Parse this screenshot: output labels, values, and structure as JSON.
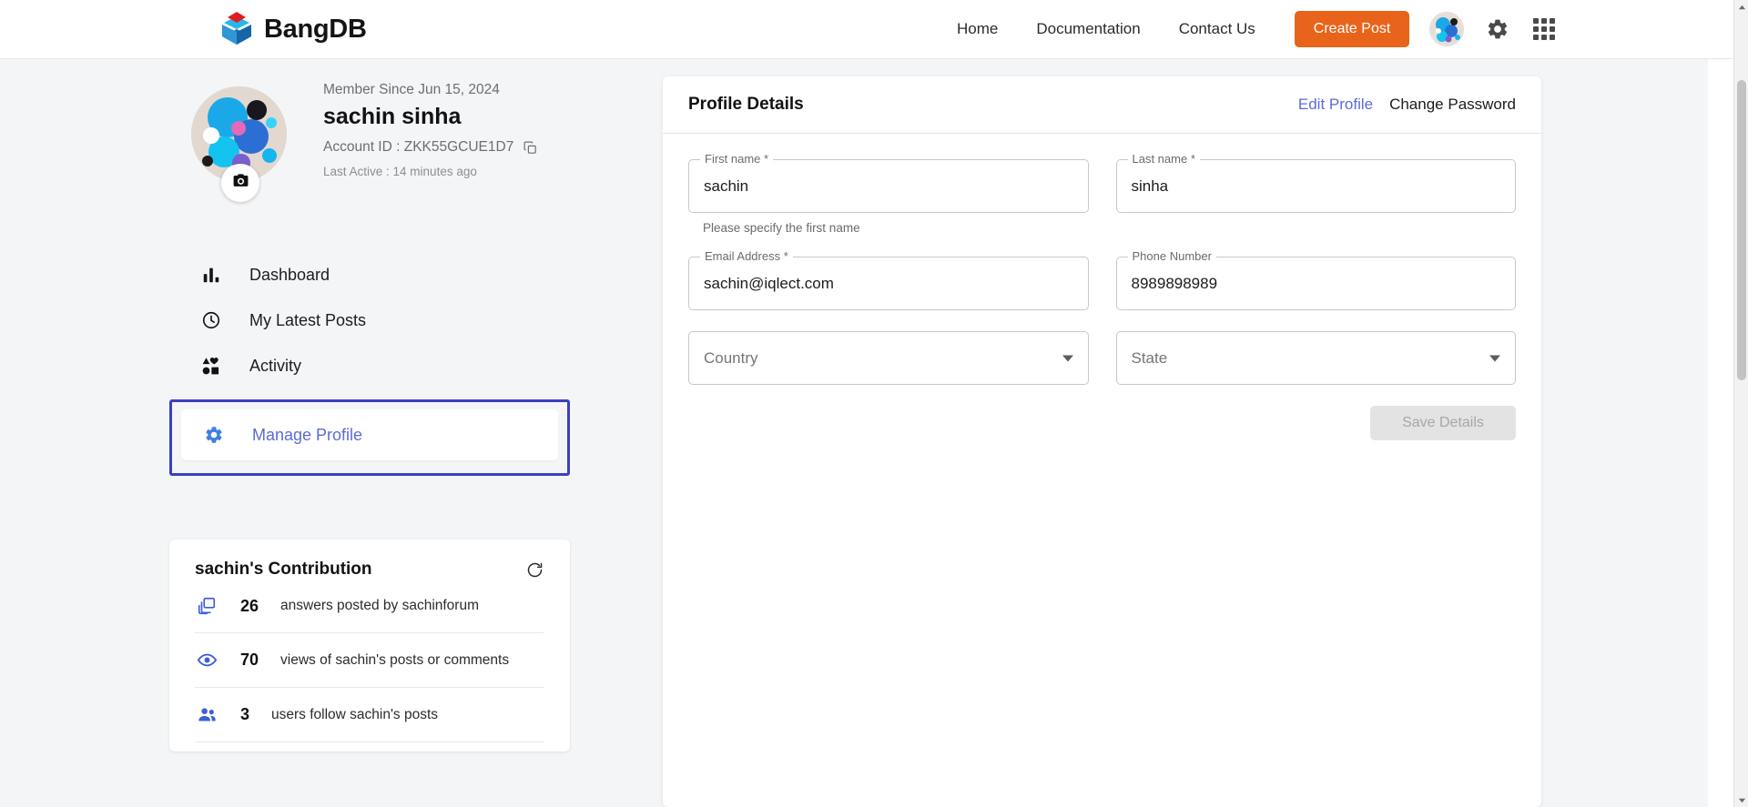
{
  "topbar": {
    "brand": "BangDB",
    "brand_logo_icon": "bangdb-cube-logo",
    "nav": [
      {
        "label": "Home",
        "name": "nav-home"
      },
      {
        "label": "Documentation",
        "name": "nav-documentation"
      },
      {
        "label": "Contact Us",
        "name": "nav-contact-us"
      }
    ],
    "create_post_label": "Create Post",
    "create_post_color": "#e8641a",
    "avatar_icon": "user-avatar",
    "settings_icon": "gear-icon",
    "apps_icon": "apps-grid-icon"
  },
  "profile": {
    "member_since": "Member Since Jun 15, 2024",
    "name": "sachin sinha",
    "account_id": "Account ID : ZKK55GCUE1D7",
    "copy_icon": "copy-icon",
    "last_active": "Last Active : 14 minutes ago",
    "camera_icon": "camera-icon",
    "avatar_icon": "profile-avatar"
  },
  "sidebar": {
    "items": [
      {
        "label": "Dashboard",
        "icon": "bar-chart-icon",
        "active": false
      },
      {
        "label": "My Latest Posts",
        "icon": "clock-icon",
        "active": false
      },
      {
        "label": "Activity",
        "icon": "shapes-icon",
        "active": false
      },
      {
        "label": "Manage Profile",
        "icon": "gear-icon",
        "active": true
      }
    ],
    "active_color": "#5b6bd6",
    "highlight_border_color": "#3b3fc4"
  },
  "contribution": {
    "title": "sachin's Contribution",
    "refresh_icon": "refresh-icon",
    "rows": [
      {
        "icon": "answers-copy-icon",
        "count": "26",
        "text": "answers posted by sachinforum"
      },
      {
        "icon": "eye-icon",
        "count": "70",
        "text": "views of sachin's posts or comments"
      },
      {
        "icon": "people-icon",
        "count": "3",
        "text": "users follow sachin's posts"
      }
    ]
  },
  "panel": {
    "title": "Profile Details",
    "edit_profile_label": "Edit Profile",
    "change_password_label": "Change Password",
    "fields": {
      "first_name": {
        "label": "First name *",
        "value": "sachin",
        "helper": "Please specify the first name"
      },
      "last_name": {
        "label": "Last name *",
        "value": "sinha"
      },
      "email": {
        "label": "Email Address *",
        "value": "sachin@iqlect.com"
      },
      "phone": {
        "label": "Phone Number",
        "value": "8989898989"
      },
      "country": {
        "placeholder": "Country",
        "value": ""
      },
      "state": {
        "placeholder": "State",
        "value": ""
      }
    },
    "save_label": "Save Details",
    "save_disabled": true
  },
  "scrollbar": {
    "up_icon": "chevron-up-icon",
    "down_icon": "chevron-down-icon"
  }
}
